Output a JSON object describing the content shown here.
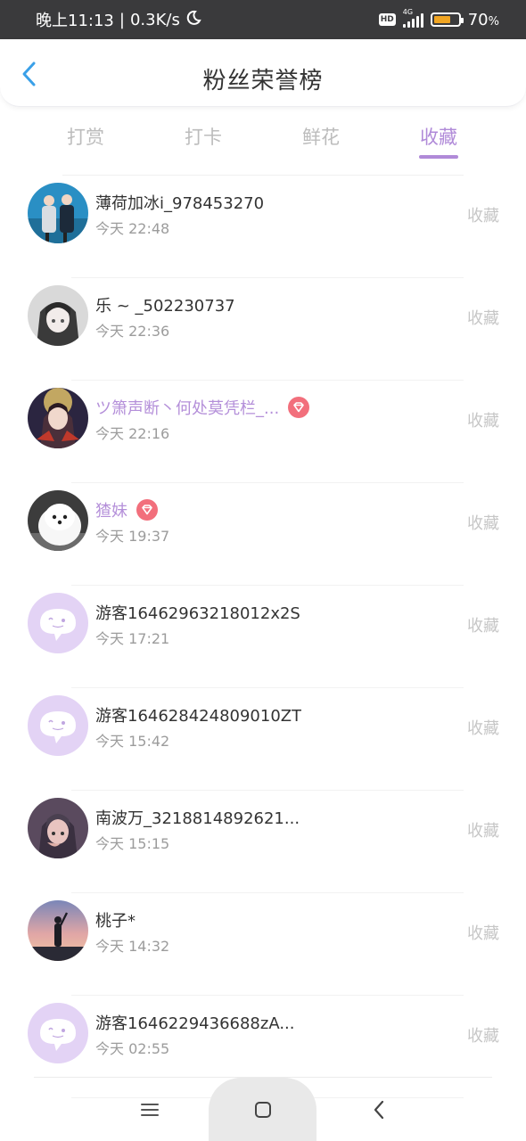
{
  "status_bar": {
    "time": "晚上11:13",
    "separator": "|",
    "speed": "0.3K/s",
    "hd": "HD",
    "network": "4G",
    "battery_percent": "70",
    "battery_suffix": "%",
    "battery_level": 0.7,
    "battery_color": "#f0a523"
  },
  "header": {
    "title": "粉丝荣誉榜",
    "back_icon": "chevron-left-icon"
  },
  "tabs": [
    {
      "label": "打赏"
    },
    {
      "label": "打卡"
    },
    {
      "label": "鲜花"
    },
    {
      "label": "收藏"
    }
  ],
  "active_tab": "收藏",
  "accent_color": "#b08ad8",
  "list": [
    {
      "name": "薄荷加冰i_978453270",
      "time": "今天 22:48",
      "action": "收藏",
      "vip": false,
      "avatar": "photo-two-people"
    },
    {
      "name": "乐 ~ _502230737",
      "time": "今天 22:36",
      "action": "收藏",
      "vip": false,
      "avatar": "photo-anime-girl"
    },
    {
      "name": "ツ箫声断丶何处莫凭栏_...",
      "time": "今天 22:16",
      "action": "收藏",
      "vip": true,
      "avatar": "photo-anime-boy"
    },
    {
      "name": "猹妹",
      "time": "今天 19:37",
      "action": "收藏",
      "vip": true,
      "avatar": "photo-white-dog"
    },
    {
      "name": "游客16462963218012x2S",
      "time": "今天 17:21",
      "action": "收藏",
      "vip": false,
      "avatar": "default-chat-avatar"
    },
    {
      "name": "游客164628424809010ZT",
      "time": "今天 15:42",
      "action": "收藏",
      "vip": false,
      "avatar": "default-chat-avatar"
    },
    {
      "name": "南波万_3218814892621...",
      "time": "今天 15:15",
      "action": "收藏",
      "vip": false,
      "avatar": "photo-anime-boy-dark"
    },
    {
      "name": "桃子*",
      "time": "今天 14:32",
      "action": "收藏",
      "vip": false,
      "avatar": "photo-sunset"
    },
    {
      "name": "游客1646229436688zA...",
      "time": "今天 02:55",
      "action": "收藏",
      "vip": false,
      "avatar": "default-chat-avatar"
    }
  ],
  "nav_bar": {
    "menu_icon": "menu-icon",
    "home_icon": "home-square-icon",
    "back_icon": "back-triangle-icon"
  }
}
